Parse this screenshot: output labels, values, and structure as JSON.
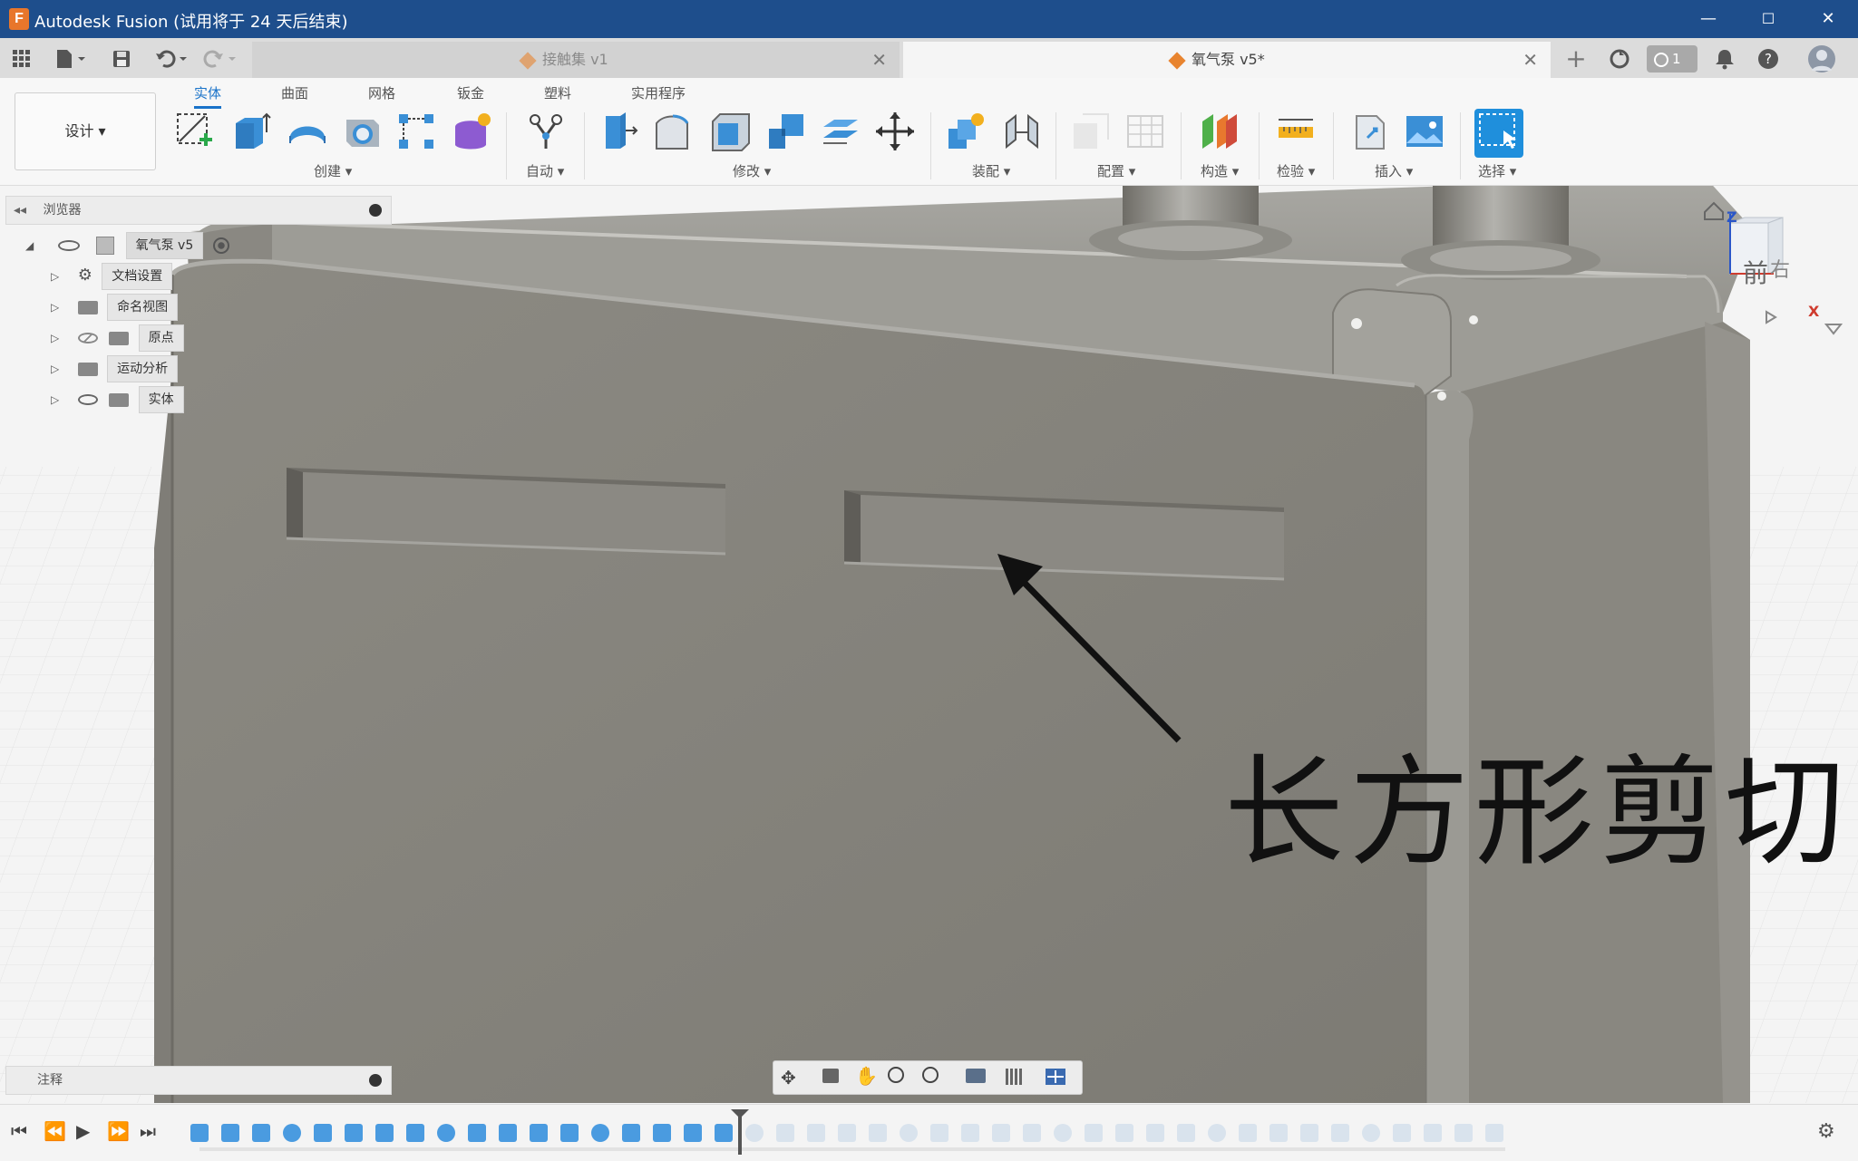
{
  "window": {
    "title": "Autodesk Fusion (试用将于 24 天后结束)",
    "app_icon_letter": "F",
    "minimize": "—",
    "maximize": "☐",
    "close": "✕"
  },
  "tabs": [
    {
      "label": "接触集 v1",
      "close": "✕"
    },
    {
      "label": "氧气泵 v5*",
      "close": "✕"
    }
  ],
  "tabbar_right": {
    "add": "+",
    "job_status_count": "1"
  },
  "workspace": {
    "label": "设计 ▾"
  },
  "ribbon_tabs": [
    "实体",
    "曲面",
    "网格",
    "钣金",
    "塑料",
    "实用程序"
  ],
  "ribbon_groups": [
    "创建 ▾",
    "自动 ▾",
    "修改 ▾",
    "装配 ▾",
    "配置 ▾",
    "构造 ▾",
    "检验 ▾",
    "插入 ▾",
    "选择 ▾"
  ],
  "browser": {
    "title": "浏览器",
    "root": "氧气泵 v5",
    "items": [
      "文档设置",
      "命名视图",
      "原点",
      "运动分析",
      "实体"
    ]
  },
  "viewcube": {
    "face_front": "前",
    "face_right": "右",
    "axis_z": "Z",
    "axis_x": "X"
  },
  "notes_panel": {
    "title": "注释"
  },
  "annotation": {
    "text": "长方形剪切"
  },
  "colors": {
    "accent": "#1a73c9",
    "titlebar": "#1e4e8c",
    "model_body": "#8a877f",
    "tool_blue": "#3a8fd6",
    "brand_orange": "#e8762b"
  }
}
